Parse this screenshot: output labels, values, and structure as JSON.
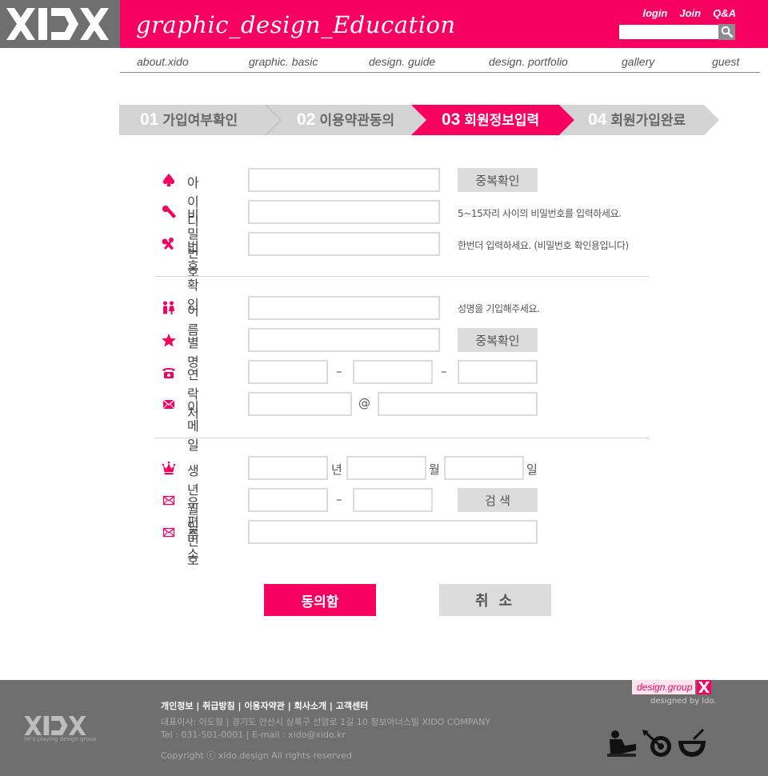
{
  "header": {
    "logo_text": "XIDO",
    "tagline": "graphic_design_Education",
    "links": [
      "login",
      "Join",
      "Q&A"
    ],
    "search_placeholder": ""
  },
  "nav": [
    "about.xido",
    "graphic. basic",
    "design. guide",
    "design. portfolio",
    "gallery",
    "guest"
  ],
  "steps": [
    {
      "num": "01",
      "label": "가입여부확인",
      "active": false
    },
    {
      "num": "02",
      "label": "이용약관동의",
      "active": false
    },
    {
      "num": "03",
      "label": "회원정보입력",
      "active": true
    },
    {
      "num": "04",
      "label": "회원가입완료",
      "active": false
    }
  ],
  "form": {
    "id_label": "아이디",
    "pw_label": "비밀번호",
    "pw_confirm_label": "번호확인",
    "name_label": "이름",
    "nick_label": "별명",
    "phone_label": "연락처",
    "email_label": "이메일",
    "birth_label": "생년월일",
    "zip_label": "우편번호",
    "addr_label": "주소",
    "dup_check": "중복확인",
    "pw_hint": "5~15자리 사이의 비밀번호를 입력하세요.",
    "pw_confirm_hint": "한번더 입력하세요. (비밀번호 확인용입니다)",
    "name_hint": "성명을 기입해주세요.",
    "dash": "–",
    "at": "@",
    "year": "년",
    "month": "월",
    "day": "일",
    "search_btn": "검 색",
    "agree_btn": "동의함",
    "cancel_btn": "취 소"
  },
  "footer": {
    "logo_text": "XIDO",
    "logo_tag": "let's playing design group",
    "links": "개인정보  |  취급방침  |  이용자약관  |  회사소개  |  고객센터",
    "address": "대표이사: 이도형 | 경기도 안산시 상록구 선암로 1길 10 청보아너스빌 XIDO COMPANY",
    "tel": "Tel : 031-501-0001  |  E-mail : xido@xido.kr",
    "copyright": "Copyright ⓒ xido.design All rights reserved",
    "badge": "design.group",
    "designed_by": "designed by ldo."
  },
  "colors": {
    "accent": "#f7005f",
    "gray": "#6f6f6f",
    "light": "#dcdcdc"
  }
}
